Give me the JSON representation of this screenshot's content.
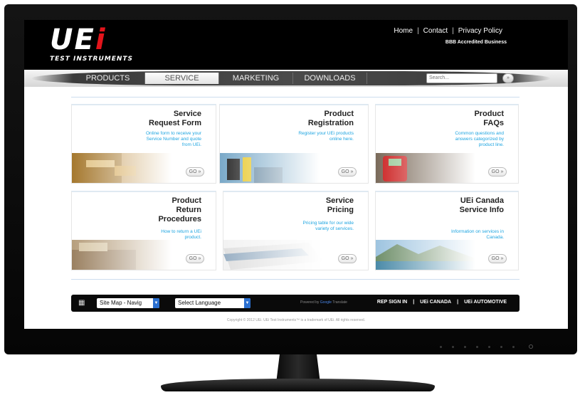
{
  "header": {
    "logo_text": "UEi",
    "logo_subtitle": "TEST INSTRUMENTS",
    "links": [
      "Home",
      "Contact",
      "Privacy Policy"
    ],
    "bbb": "BBB Accredited Business"
  },
  "nav": {
    "tabs": [
      {
        "label": "PRODUCTS"
      },
      {
        "label": "SERVICE",
        "active": true
      },
      {
        "label": "MARKETING"
      },
      {
        "label": "DOWNLOADS"
      }
    ],
    "search_placeholder": "Search...",
    "search_button": "»"
  },
  "cards": [
    {
      "title": "Service Request Form",
      "desc": "Online form to receive your Service Number and quote from UEi.",
      "button": "GO »"
    },
    {
      "title": "Product Registration",
      "desc": "Register your UEi products online here.",
      "button": "GO »"
    },
    {
      "title": "Product FAQs",
      "desc": "Common questions and answers categorized by product line.",
      "button": "GO »"
    },
    {
      "title": "Product Return Procedures",
      "desc": "How to return a UEi product.",
      "button": "GO »"
    },
    {
      "title": "Service Pricing",
      "desc": "Pricing table for our wide variety of services.",
      "button": "GO »"
    },
    {
      "title": "UEi Canada Service Info",
      "desc": "Information on services in Canada.",
      "button": "GO »"
    }
  ],
  "footer": {
    "sitemap_select": "Site Map - Navig",
    "language_select": "Select Language",
    "powered_by": "Powered by",
    "google": "Google",
    "translate": "Translate",
    "links": [
      "REP SIGN IN",
      "UEi CANADA",
      "UEi AUTOMOTIVE"
    ],
    "copyright": "Copyright © 2012 UEi. UEi Test Instruments™ is a trademark of UEi. All rights reserved."
  },
  "colors": {
    "accent_blue": "#1da4e0",
    "brand_red": "#e3141b"
  }
}
